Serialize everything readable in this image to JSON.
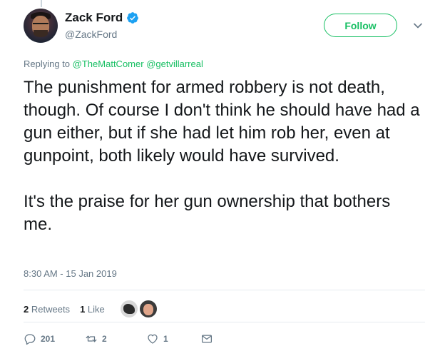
{
  "author": {
    "display_name": "Zack Ford",
    "handle": "@ZackFord",
    "verified": true
  },
  "header": {
    "follow_label": "Follow"
  },
  "reply_context": {
    "prefix": "Replying to",
    "mentions": [
      "@TheMattComer",
      "@getvillarreal"
    ]
  },
  "tweet": {
    "paragraphs": [
      "The punishment for armed robbery is not death, though. Of course I don't think he should have had a gun either, but if she had let him rob her, even at gunpoint, both likely would have survived.",
      "It's the praise for her gun ownership that bothers me."
    ],
    "timestamp": "8:30 AM - 15 Jan 2019"
  },
  "stats": {
    "retweets_count": "2",
    "retweets_label": "Retweets",
    "likes_count": "1",
    "likes_label": "Like"
  },
  "actions": {
    "reply_count": "201",
    "retweet_count": "2",
    "like_count": "1"
  },
  "colors": {
    "accent": "#17bf63",
    "verified": "#1da1f2",
    "secondary_text": "#657786"
  }
}
